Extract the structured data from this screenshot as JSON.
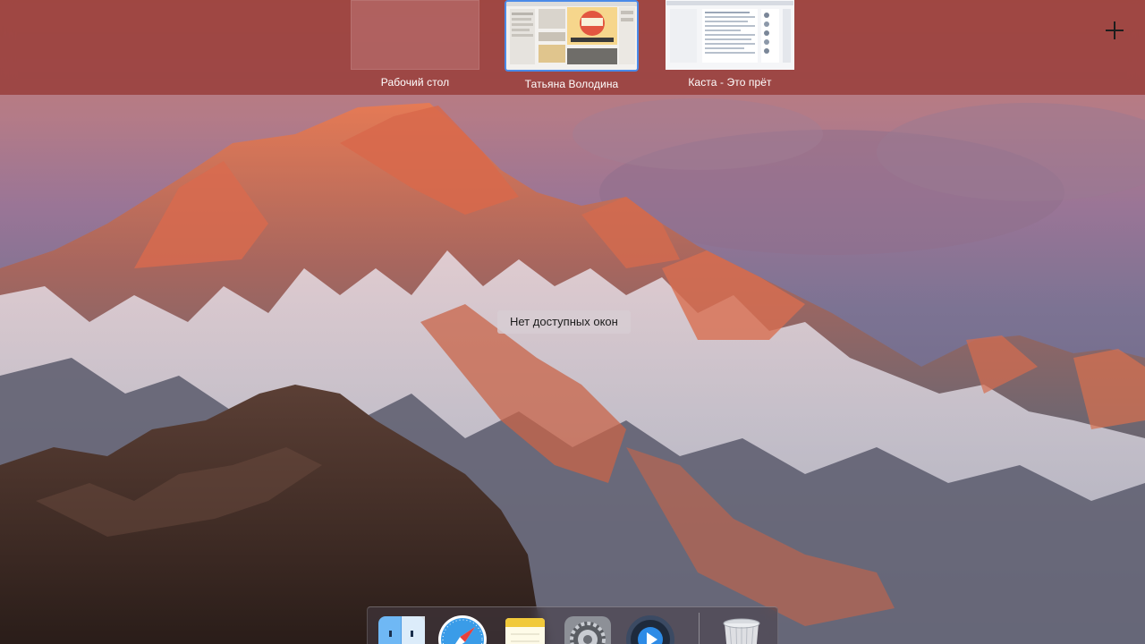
{
  "spaces": {
    "items": [
      {
        "label": "Рабочий стол"
      },
      {
        "label": "Татьяна Володина"
      },
      {
        "label": "Каста - Это прёт"
      }
    ]
  },
  "add_space": {
    "icon": "plus-icon"
  },
  "no_windows_text": "Нет доступных окон",
  "dock": {
    "items": [
      {
        "icon": "finder-icon"
      },
      {
        "icon": "safari-icon"
      },
      {
        "icon": "notes-icon"
      },
      {
        "icon": "system-preferences-icon"
      },
      {
        "icon": "quicktime-icon"
      },
      {
        "icon": "trash-icon"
      }
    ]
  },
  "colors": {
    "spaces_bar": "#963834",
    "active_space_border": "#4a8ae8"
  }
}
